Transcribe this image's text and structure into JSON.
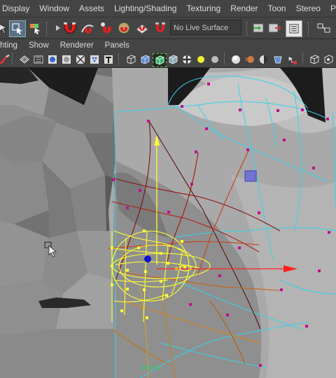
{
  "menubar": {
    "items": [
      "Display",
      "Window",
      "Assets",
      "Lighting/Shading",
      "Texturing",
      "Render",
      "Toon",
      "Stereo",
      "Paint Ef"
    ]
  },
  "shelf": {
    "live_surface": "No Live Surface"
  },
  "panel_menu": {
    "items": [
      "hting",
      "Show",
      "Renderer",
      "Panels"
    ]
  },
  "viewport": {
    "camera_label": "persp"
  },
  "colors": {
    "ui_bg": "#444444",
    "menu_text": "#dcdcdc",
    "cage_cyan": "#36d2e8",
    "selection_yellow": "#ffff33",
    "x_axis_red": "#ff2020",
    "camera_label_green": "#2fd06b"
  }
}
